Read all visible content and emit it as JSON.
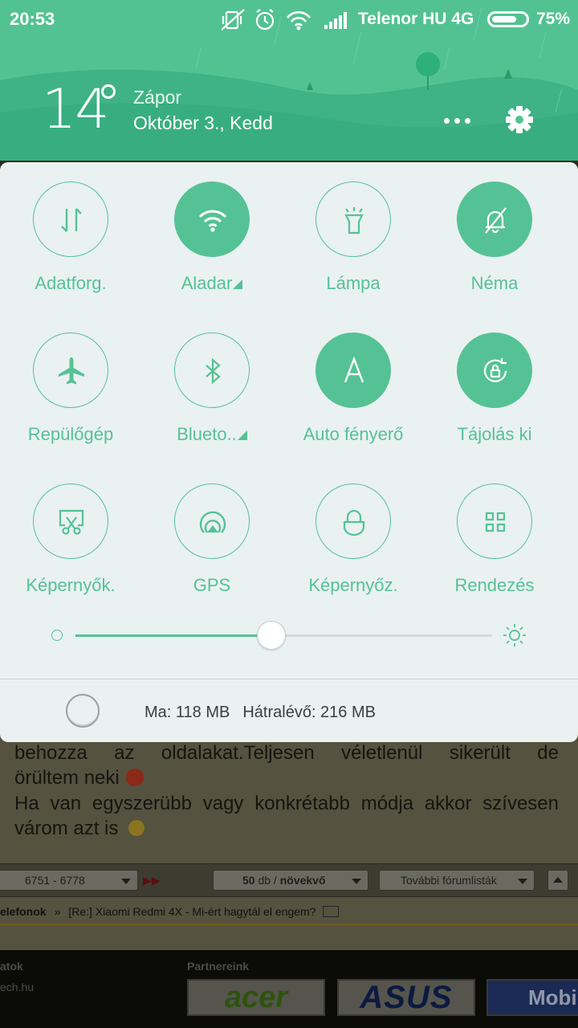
{
  "status_bar": {
    "time": "20:53",
    "carrier": "Telenor HU 4G",
    "battery_pct": "75%",
    "battery_level": 0.75,
    "icons": [
      "vibrate-off-icon",
      "alarm-icon",
      "wifi-icon",
      "signal-icon"
    ]
  },
  "weather": {
    "temperature": "14",
    "condition": "Zápor",
    "date": "Október 3., Kedd"
  },
  "tiles": [
    {
      "label": "Adatforg.",
      "icon": "data-transfer-icon",
      "active": false
    },
    {
      "label": "Aladar",
      "icon": "wifi-icon",
      "active": true,
      "has_expand": true
    },
    {
      "label": "Lámpa",
      "icon": "flashlight-icon",
      "active": false
    },
    {
      "label": "Néma",
      "icon": "bell-off-icon",
      "active": true
    },
    {
      "label": "Repülőgép",
      "icon": "airplane-icon",
      "active": false
    },
    {
      "label": "Blueto..",
      "icon": "bluetooth-icon",
      "active": false,
      "has_expand": true
    },
    {
      "label": "Auto fényerő",
      "icon": "auto-brightness-icon",
      "active": true
    },
    {
      "label": "Tájolás ki",
      "icon": "rotation-lock-icon",
      "active": true
    },
    {
      "label": "Képernyők.",
      "icon": "screenshot-icon",
      "active": false
    },
    {
      "label": "GPS",
      "icon": "gps-icon",
      "active": false
    },
    {
      "label": "Képernyőz.",
      "icon": "lock-screen-icon",
      "active": false
    },
    {
      "label": "Rendezés",
      "icon": "grid-icon",
      "active": false
    }
  ],
  "brightness": {
    "level": 0.47
  },
  "memory": {
    "used": "Ma: 118 MB",
    "remaining": "Hátralévő: 216 MB"
  },
  "background_page": {
    "line1": "behozza az oldalakat.Teljesen véletlenül sikerült de",
    "line2": "örültem neki",
    "line3": "Ha van egyszerübb vagy konkrétabb módja akkor szívesen",
    "line4": "várom azt is",
    "pager_range": "6751 - 6778",
    "pager_count_bold": "50",
    "pager_count_rest": "db / ",
    "pager_sort": "növekvő",
    "pager_more": "További fórumlisták",
    "breadcrumb_section": "elefonok",
    "breadcrumb_sep": "»",
    "breadcrumb_topic": "[Re:] Xiaomi Redmi 4X - Mi-ért hagytál el engem?",
    "footer_heading_left": "atok",
    "footer_text_left": "ech.hu",
    "footer_heading_partners": "Partnereink",
    "logo_acer": "acer",
    "logo_asus": "ASUS",
    "logo_mobil": "Mobil D"
  },
  "colors": {
    "accent": "#55c295",
    "header_bg": "#53c292",
    "panel_bg": "#eaf1f1"
  }
}
